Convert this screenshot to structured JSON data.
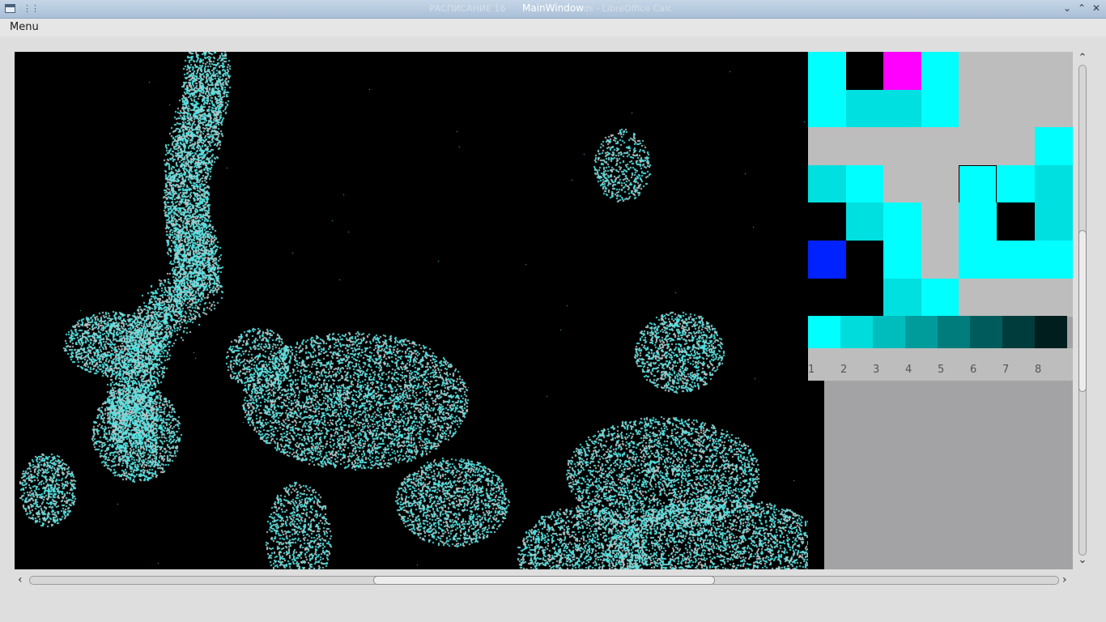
{
  "window": {
    "title": "MainWindow",
    "ghost_left": "РАСПИСАНИЕ 16",
    "ghost_right": "ds - LibreOffice Calc"
  },
  "menu": {
    "label": "Menu"
  },
  "canvas": {
    "background": "#000000",
    "particle_color": "#4fe0e0",
    "particle_core": "#b8c4c4"
  },
  "palette": {
    "selected_index": 25,
    "grid": [
      "#00ffff",
      "#000000",
      "#ff00ff",
      "#00ffff",
      "#bdbdbd",
      "#bdbdbd",
      "#bdbdbd",
      "#00ffff",
      "#00e0e0",
      "#00e0e0",
      "#00ffff",
      "#bdbdbd",
      "#bdbdbd",
      "#bdbdbd",
      "#bdbdbd",
      "#bdbdbd",
      "#bdbdbd",
      "#bdbdbd",
      "#bdbdbd",
      "#bdbdbd",
      "#00ffff",
      "#00e0e0",
      "#00ffff",
      "#bdbdbd",
      "#bdbdbd",
      "#00ffff",
      "#00ffff",
      "#00e0e0",
      "#000000",
      "#00e0e0",
      "#00ffff",
      "#bdbdbd",
      "#00ffff",
      "#000000",
      "#00e0e0",
      "#0022ff",
      "#000000",
      "#00ffff",
      "#bdbdbd",
      "#00ffff",
      "#00ffff",
      "#00ffff",
      "#000000",
      "#000000",
      "#00e0e0",
      "#00ffff",
      "#bdbdbd",
      "#bdbdbd",
      "#bdbdbd"
    ],
    "ramp": [
      "#00ffff",
      "#00dcdc",
      "#00bdbd",
      "#009c9c",
      "#007c7c",
      "#005c5c",
      "#003c3c",
      "#001e1e"
    ],
    "numbers": [
      "1",
      "2",
      "3",
      "4",
      "5",
      "6",
      "7",
      "8"
    ]
  },
  "scrollbars": {
    "up_icon": "chevron-up-icon",
    "down_icon": "chevron-down-icon",
    "left_icon": "chevron-left-icon",
    "right_icon": "chevron-right-icon"
  }
}
